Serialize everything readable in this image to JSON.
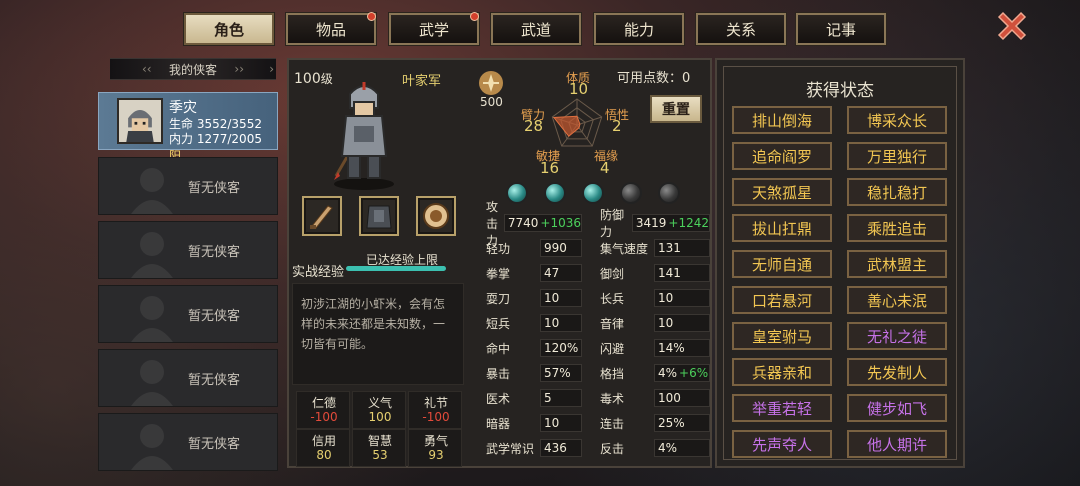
{
  "tabs": [
    {
      "label": "角色",
      "active": true,
      "dot": false
    },
    {
      "label": "物品",
      "active": false,
      "dot": true
    },
    {
      "label": "武学",
      "active": false,
      "dot": true
    },
    {
      "label": "武道",
      "active": false,
      "dot": false
    },
    {
      "label": "能力",
      "active": false,
      "dot": false
    },
    {
      "label": "关系",
      "active": false,
      "dot": false
    },
    {
      "label": "记事",
      "active": false,
      "dot": false
    }
  ],
  "left": {
    "title": "我的侠客",
    "hero": {
      "name": "季灾",
      "hp_label": "生命",
      "hp": "3552/3552",
      "mp_label": "内力",
      "mp": "1277/2005",
      "yinyang": "阳"
    },
    "empty_label": "暂无侠客"
  },
  "center": {
    "level": "100",
    "level_unit": "级",
    "faction": "叶家军",
    "power_value": "500",
    "points_label": "可用点数",
    "points_value": "0",
    "reset_label": "重置",
    "radar": {
      "tizhi": {
        "label": "体质",
        "value": "10"
      },
      "bili": {
        "label": "臂力",
        "value": "28"
      },
      "wuxing": {
        "label": "悟性",
        "value": "2"
      },
      "minjie": {
        "label": "敏捷",
        "value": "16"
      },
      "fuyuan": {
        "label": "福缘",
        "value": "4"
      }
    },
    "xp_label": "实战经验",
    "xp_status": "已达经验上限",
    "xp_fill": 1.0,
    "description": "初涉江湖的小虾米，会有怎样的未来还都是未知数，一切皆有可能。",
    "virtues": [
      {
        "label": "仁德",
        "value": "-100",
        "neg": true
      },
      {
        "label": "义气",
        "value": "100",
        "neg": false
      },
      {
        "label": "礼节",
        "value": "-100",
        "neg": true
      },
      {
        "label": "信用",
        "value": "80",
        "neg": false
      },
      {
        "label": "智慧",
        "value": "53",
        "neg": false
      },
      {
        "label": "勇气",
        "value": "93",
        "neg": false
      }
    ],
    "orbs": [
      true,
      true,
      true,
      false,
      false
    ],
    "stats_left": [
      {
        "label": "攻击力",
        "value": "7740",
        "bonus": "+1036"
      },
      {
        "label": "轻功",
        "value": "990",
        "bonus": ""
      },
      {
        "label": "拳掌",
        "value": "47",
        "bonus": ""
      },
      {
        "label": "耍刀",
        "value": "10",
        "bonus": ""
      },
      {
        "label": "短兵",
        "value": "10",
        "bonus": ""
      },
      {
        "label": "命中",
        "value": "120%",
        "bonus": ""
      },
      {
        "label": "暴击",
        "value": "57%",
        "bonus": ""
      },
      {
        "label": "医术",
        "value": "5",
        "bonus": ""
      },
      {
        "label": "暗器",
        "value": "10",
        "bonus": ""
      },
      {
        "label": "武学常识",
        "value": "436",
        "bonus": ""
      }
    ],
    "stats_right": [
      {
        "label": "防御力",
        "value": "3419",
        "bonus": "+1242"
      },
      {
        "label": "集气速度",
        "value": "131",
        "bonus": ""
      },
      {
        "label": "御剑",
        "value": "141",
        "bonus": ""
      },
      {
        "label": "长兵",
        "value": "10",
        "bonus": ""
      },
      {
        "label": "音律",
        "value": "10",
        "bonus": ""
      },
      {
        "label": "闪避",
        "value": "14%",
        "bonus": ""
      },
      {
        "label": "格挡",
        "value": "4%",
        "bonus": "+6%"
      },
      {
        "label": "毒术",
        "value": "100",
        "bonus": ""
      },
      {
        "label": "连击",
        "value": "25%",
        "bonus": ""
      },
      {
        "label": "反击",
        "value": "4%",
        "bonus": ""
      }
    ]
  },
  "right": {
    "title": "获得状态",
    "statuses": [
      {
        "label": "排山倒海",
        "color": "gold"
      },
      {
        "label": "博采众长",
        "color": "gold"
      },
      {
        "label": "追命阎罗",
        "color": "gold"
      },
      {
        "label": "万里独行",
        "color": "gold"
      },
      {
        "label": "天煞孤星",
        "color": "gold"
      },
      {
        "label": "稳扎稳打",
        "color": "gold"
      },
      {
        "label": "拔山扛鼎",
        "color": "gold"
      },
      {
        "label": "乘胜追击",
        "color": "gold"
      },
      {
        "label": "无师自通",
        "color": "gold"
      },
      {
        "label": "武林盟主",
        "color": "gold"
      },
      {
        "label": "口若悬河",
        "color": "gold"
      },
      {
        "label": "善心未泯",
        "color": "gold"
      },
      {
        "label": "皇室驸马",
        "color": "gold"
      },
      {
        "label": "无礼之徒",
        "color": "purple"
      },
      {
        "label": "兵器亲和",
        "color": "gold"
      },
      {
        "label": "先发制人",
        "color": "gold"
      },
      {
        "label": "举重若轻",
        "color": "purple"
      },
      {
        "label": "健步如飞",
        "color": "purple"
      },
      {
        "label": "先声夺人",
        "color": "purple"
      },
      {
        "label": "他人期许",
        "color": "purple"
      }
    ]
  },
  "colors": {
    "gold": "#f2c652",
    "purple": "#c672e8",
    "negative": "#e24a3a",
    "bonus": "#4cd05c"
  }
}
